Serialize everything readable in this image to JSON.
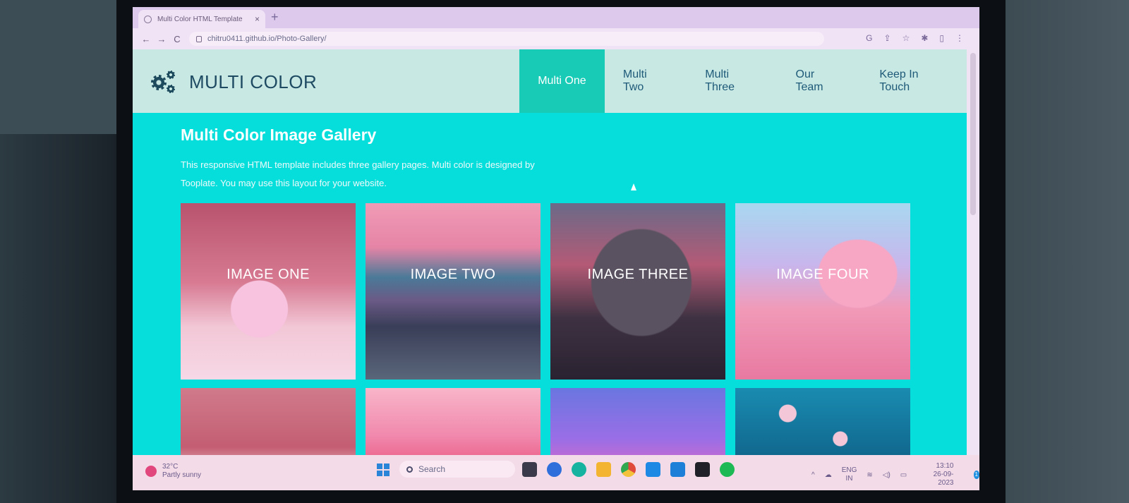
{
  "browser": {
    "tab_title": "Multi Color HTML Template",
    "tab_close": "×",
    "new_tab": "+",
    "url": "chitru0411.github.io/Photo-Gallery/",
    "nav_back": "←",
    "nav_forward": "→",
    "nav_reload": "C",
    "toolbar_icons": [
      "G",
      "⇪",
      "☆",
      "✱",
      "▯",
      "⋮"
    ]
  },
  "site": {
    "brand": "MULTI COLOR",
    "menu": [
      "Multi One",
      "Multi Two",
      "Multi Three",
      "Our Team",
      "Keep In Touch"
    ],
    "active_menu": "Multi One",
    "heading": "Multi Color Image Gallery",
    "description": "This responsive HTML template includes three gallery pages. Multi color is designed by Tooplate. You may use this layout for your website.",
    "gallery": [
      "IMAGE ONE",
      "IMAGE TWO",
      "IMAGE THREE",
      "IMAGE FOUR"
    ]
  },
  "taskbar": {
    "weather_temp": "32°C",
    "weather_desc": "Partly sunny",
    "search": "Search",
    "lang_top": "ENG",
    "lang_bottom": "IN",
    "time": "13:10",
    "date": "26-09-2023",
    "notifications": "1",
    "apps": [
      "file-explorer-icon",
      "chat-icon",
      "edge-icon",
      "folder-icon",
      "chrome-icon",
      "vscode-icon",
      "mail-icon",
      "terminal-icon",
      "spotify-icon"
    ]
  },
  "colors": {
    "page_bg": "#06dedc",
    "nav_bg": "#c8e8e4",
    "active_menu_bg": "#18cbb6",
    "brand_text": "#1e4a62"
  }
}
